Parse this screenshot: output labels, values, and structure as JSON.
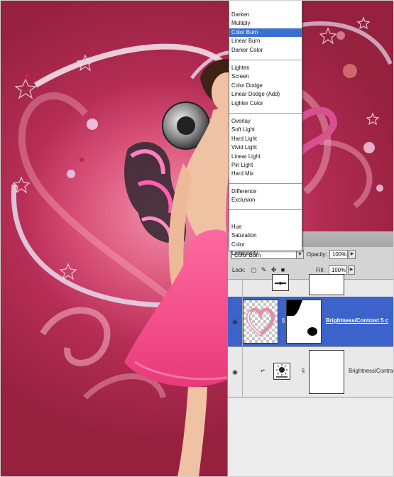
{
  "blend_menu": {
    "groups": [
      [
        "Darken",
        "Multiply",
        "Color Burn",
        "Linear Burn",
        "Darker Color"
      ],
      [
        "Lighten",
        "Screen",
        "Color Dodge",
        "Linear Dodge (Add)",
        "Lighter Color"
      ],
      [
        "Overlay",
        "Soft Light",
        "Hard Light",
        "Vivid Light",
        "Linear Light",
        "Pin Light",
        "Hard Mix"
      ],
      [
        "Difference",
        "Exclusion"
      ],
      [
        "Hue",
        "Saturation",
        "Color",
        "Luminosity"
      ]
    ],
    "selected": "Color Burn"
  },
  "layers_panel": {
    "blend_mode": "Color Burn",
    "opacity_label": "Opacity:",
    "opacity_value": "100%",
    "lock_label": "Lock:",
    "fill_label": "Fill:",
    "fill_value": "100%",
    "layers": [
      {
        "name": "",
        "selected": false
      },
      {
        "name": "Brightness/Contrast 5 c",
        "selected": true
      },
      {
        "name": "Brightness/Contrast",
        "selected": false
      }
    ]
  },
  "colors": {
    "background": "#a62a4f",
    "highlight": "#3b6fd0",
    "dress": "#f0508a"
  },
  "icons": [
    "eye-icon",
    "link-icon",
    "brush-lock-icon",
    "move-lock-icon",
    "padlock-icon",
    "transparency-lock-icon",
    "brightness-adjustment-icon",
    "clip-arrow-icon"
  ]
}
